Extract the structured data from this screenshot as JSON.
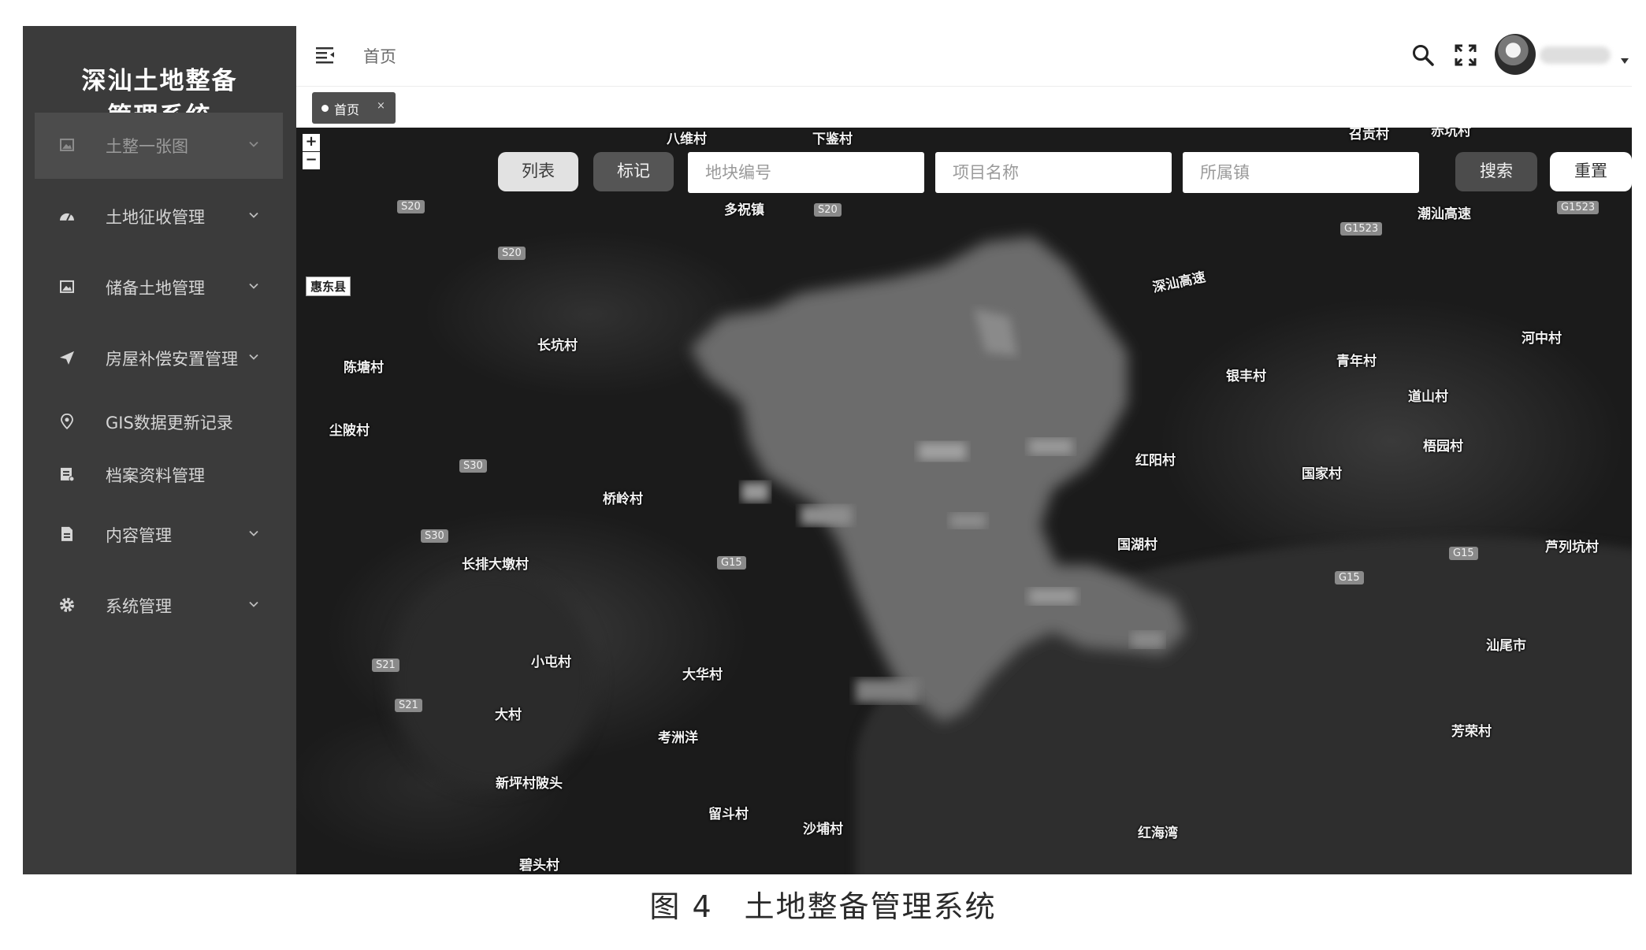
{
  "sidebar": {
    "brand_line1": "深汕土地整备",
    "brand_line2": "管理系统",
    "items": [
      {
        "label": "土整一张图",
        "icon": "image-icon",
        "active": true,
        "has_children": true
      },
      {
        "label": "土地征收管理",
        "icon": "dashboard-icon",
        "active": false,
        "has_children": true
      },
      {
        "label": "储备土地管理",
        "icon": "image-icon",
        "active": false,
        "has_children": true
      },
      {
        "label": "房屋补偿安置管理",
        "icon": "send-icon",
        "active": false,
        "has_children": true
      },
      {
        "label": "GIS数据更新记录",
        "icon": "location-pin-icon",
        "active": false,
        "has_children": false
      },
      {
        "label": "档案资料管理",
        "icon": "archive-icon",
        "active": false,
        "has_children": false
      },
      {
        "label": "内容管理",
        "icon": "document-icon",
        "active": false,
        "has_children": true
      },
      {
        "label": "系统管理",
        "icon": "gear-icon",
        "active": false,
        "has_children": true
      }
    ]
  },
  "header": {
    "breadcrumb": "首页",
    "icons": [
      "hamburger-icon",
      "search-icon",
      "fullscreen-icon",
      "avatar",
      "caret-down-icon"
    ]
  },
  "tags": [
    {
      "label": "首页",
      "close": "×"
    }
  ],
  "map": {
    "zoom_in": "+",
    "zoom_out": "−",
    "toolbar": {
      "list_label": "列表",
      "mark_label": "标记",
      "plot_placeholder": "地块编号",
      "project_placeholder": "项目名称",
      "town_placeholder": "所属镇",
      "search_label": "搜索",
      "reset_label": "重置"
    },
    "places": [
      "八维村",
      "下鉴村",
      "召贡村",
      "赤坑村",
      "多祝镇",
      "惠东县",
      "长坑村",
      "陈塘村",
      "尘陂村",
      "桥岭村",
      "长排大墩村",
      "小屯村",
      "大华村",
      "大村",
      "考洲洋",
      "新坪村陂头",
      "留斗村",
      "沙埔村",
      "碧头村",
      "深汕高速",
      "银丰村",
      "青年村",
      "道山村",
      "河中村",
      "梧园村",
      "红阳村",
      "国家村",
      "国湖村",
      "芦列坑村",
      "汕尾市",
      "芳荣村",
      "红海湾",
      "潮汕高速"
    ],
    "roads": [
      "S20",
      "S20",
      "S20",
      "S30",
      "S30",
      "G15",
      "S21",
      "S21",
      "G1523",
      "G1523",
      "G15",
      "G15"
    ]
  },
  "caption": "图 4　土地整备管理系统"
}
